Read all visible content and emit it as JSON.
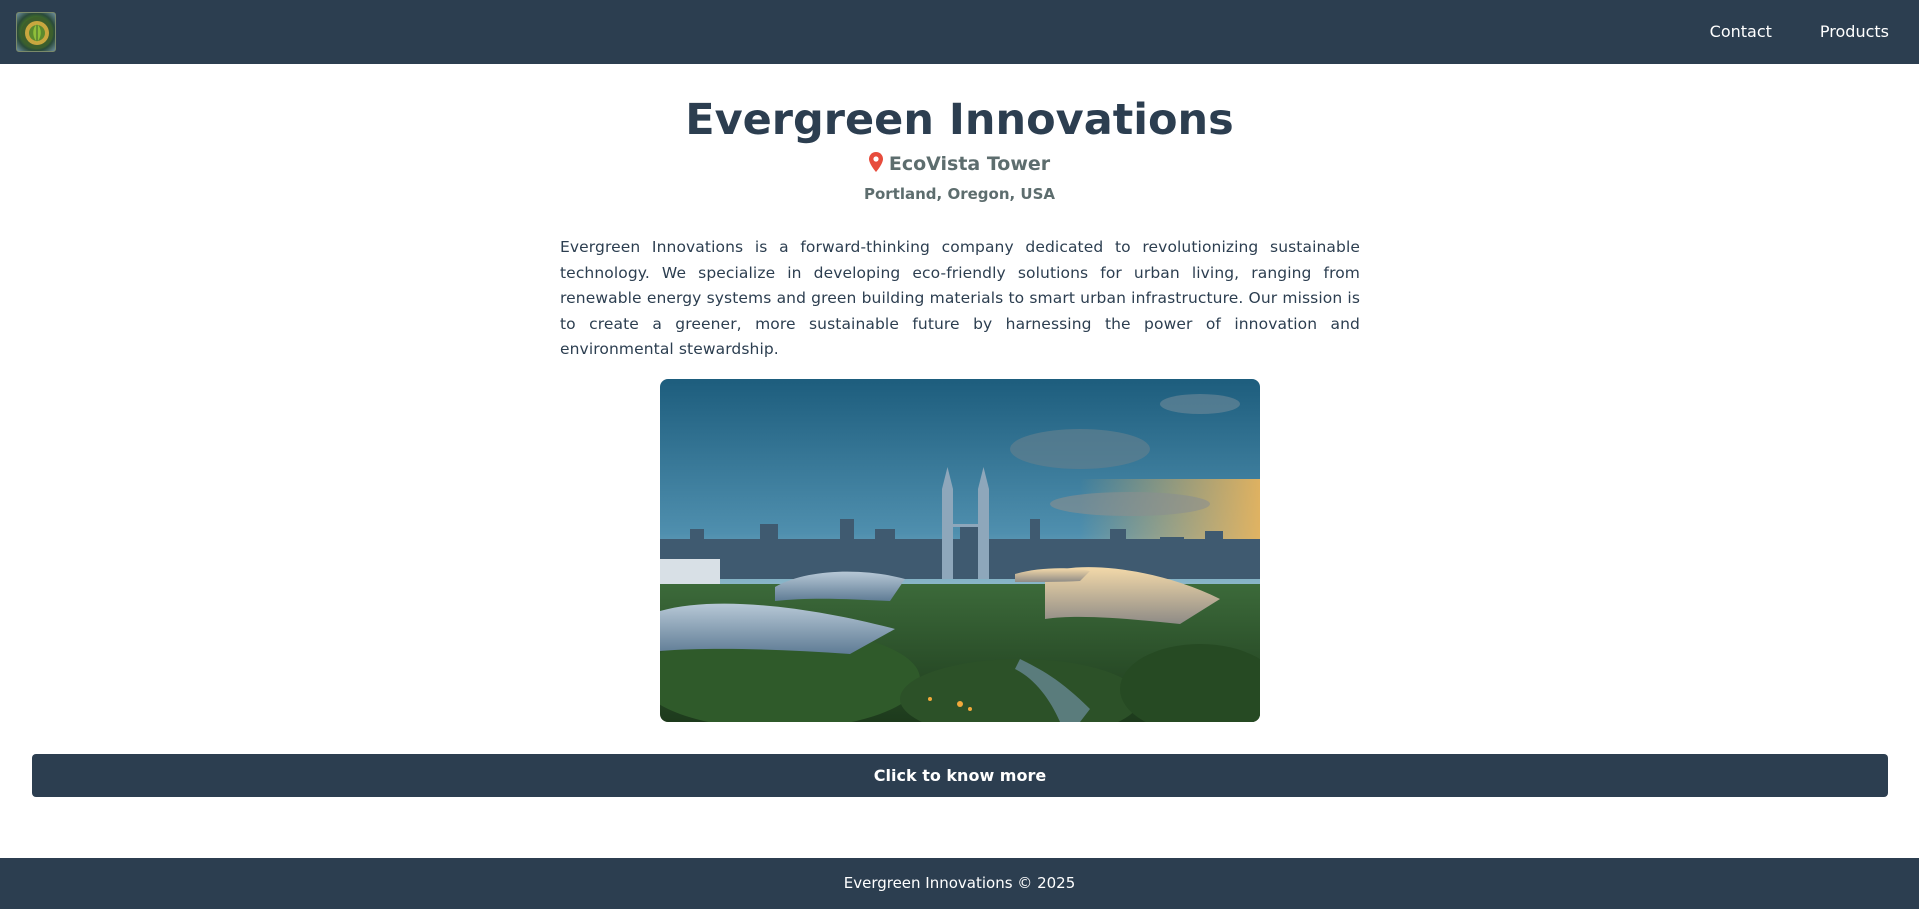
{
  "header": {
    "logo_alt": "Evergreen Innovations logo",
    "nav": [
      {
        "label": "Contact"
      },
      {
        "label": "Products"
      }
    ]
  },
  "main": {
    "company_name": "Evergreen Innovations",
    "building": "EcoVista Tower",
    "location": "Portland, Oregon, USA",
    "description": "Evergreen Innovations is a forward-thinking company dedicated to revolutionizing sustainable technology. We specialize in developing eco-friendly solutions for urban living, ranging from renewable energy systems and green building materials to smart urban infrastructure. Our mission is to create a greener, more sustainable future by harnessing the power of innovation and environmental stewardship.",
    "cta_label": "Click to know more"
  },
  "footer": {
    "text": "Evergreen Innovations © 2025"
  },
  "colors": {
    "navy": "#2c3e50",
    "muted": "#5d6d6e",
    "pin": "#e74c3c"
  },
  "icons": {
    "location": "map-pin-icon"
  }
}
